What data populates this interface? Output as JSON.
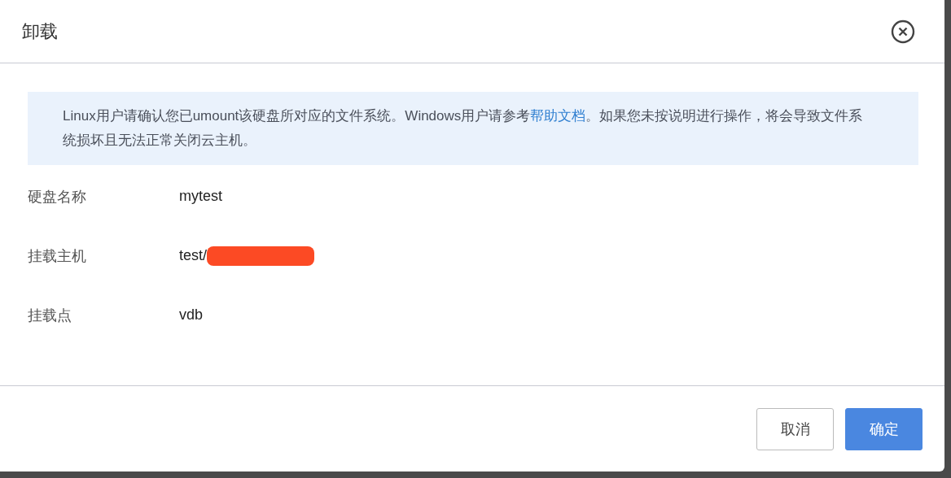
{
  "dialog": {
    "title": "卸载",
    "notice": {
      "before": "Linux用户请确认您已umount该硬盘所对应的文件系统。Windows用户请参考",
      "link": "帮助文档",
      "after": "。如果您未按说明进行操作，将会导致文件系统损坏且无法正常关闭云主机。"
    },
    "fields": [
      {
        "label": "硬盘名称",
        "value": "mytest",
        "redacted": false
      },
      {
        "label": "挂载主机",
        "value": "test/",
        "redacted": true
      },
      {
        "label": "挂载点",
        "value": "vdb",
        "redacted": false
      }
    ],
    "buttons": [
      {
        "label": "取消",
        "kind": "secondary"
      },
      {
        "label": "确定",
        "kind": "primary"
      }
    ]
  }
}
